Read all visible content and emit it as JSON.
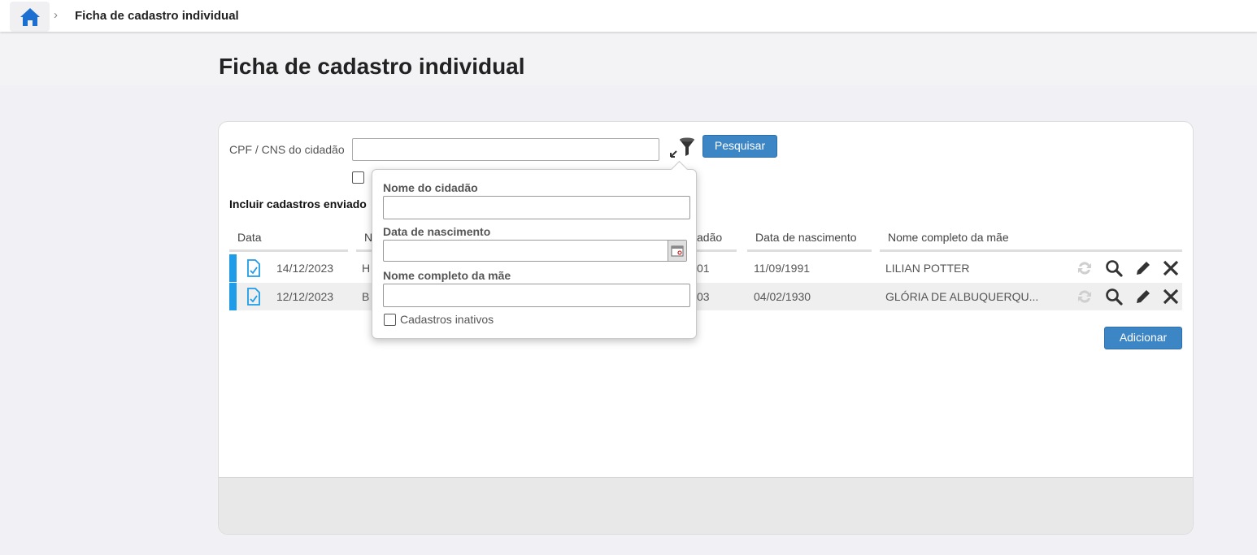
{
  "breadcrumb": {
    "title": "Ficha de cadastro individual"
  },
  "page": {
    "title": "Ficha de cadastro individual"
  },
  "search": {
    "cpf_label": "CPF / CNS do cidadão",
    "cpf_value": "",
    "search_button": "Pesquisar",
    "include_label": "Incluir cadastros enviado"
  },
  "table": {
    "headers": [
      "Data",
      "N",
      "adão",
      "Data de nascimento",
      "Nome completo da mãe"
    ],
    "rows": [
      {
        "date": "14/12/2023",
        "name": "H",
        "doc": "01",
        "birth": "11/09/1991",
        "mother": "LILIAN POTTER"
      },
      {
        "date": "12/12/2023",
        "name": "B",
        "doc": "03",
        "birth": "04/02/1930",
        "mother": "GLÓRIA DE ALBUQUERQU..."
      }
    ]
  },
  "add_button": "Adicionar",
  "filter_popover": {
    "name_label": "Nome do cidadão",
    "name_value": "",
    "birth_label": "Data de nascimento",
    "birth_value": "",
    "mother_label": "Nome completo da mãe",
    "mother_value": "",
    "inactive_label": "Cadastros inativos"
  },
  "colors": {
    "primary": "#3d86c6",
    "marker": "#1e9ce8",
    "home_icon": "#1a6fd1"
  },
  "icons": [
    "home-icon",
    "chevron-right-icon",
    "filter-icon",
    "document-check-icon",
    "sync-icon",
    "search-icon",
    "pencil-icon",
    "close-icon",
    "calendar-icon"
  ]
}
